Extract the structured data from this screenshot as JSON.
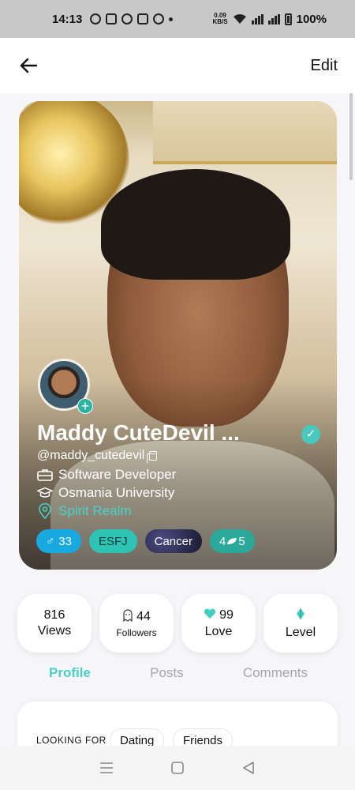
{
  "status_bar": {
    "time": "14:13",
    "speed_value": "0.09",
    "speed_unit": "KB/S",
    "battery": "100%"
  },
  "header": {
    "edit_label": "Edit"
  },
  "profile": {
    "name": "Maddy CuteDevil ...",
    "handle": "@maddy_cutedevil",
    "occupation": "Software Developer",
    "education": "Osmania University",
    "location": "Spirit Realm",
    "verified": true
  },
  "tags": {
    "age": "33",
    "mbti": "ESFJ",
    "zodiac": "Cancer",
    "plant_prefix": "4",
    "plant_suffix": "5"
  },
  "stats": [
    {
      "value": "816",
      "label": "Views"
    },
    {
      "value": "44",
      "label": "Followers"
    },
    {
      "value": "99",
      "label": "Love"
    },
    {
      "value": "",
      "label": "Level"
    }
  ],
  "tabs": [
    {
      "label": "Profile",
      "active": true
    },
    {
      "label": "Posts",
      "active": false
    },
    {
      "label": "Comments",
      "active": false
    }
  ],
  "looking_for": {
    "label": "LOOKING FOR",
    "options": [
      "Dating",
      "Friends"
    ]
  },
  "colors": {
    "accent": "#49cfc4",
    "gender_tag": "#17a9e0"
  }
}
